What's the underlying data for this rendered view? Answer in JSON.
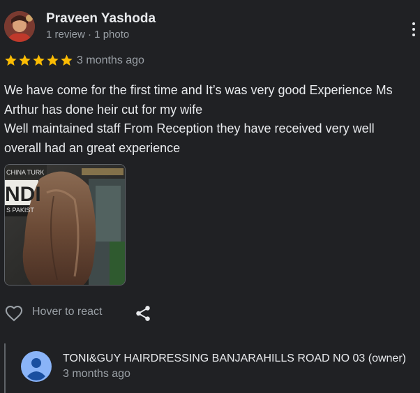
{
  "reviewer": {
    "name": "Praveen Yashoda",
    "meta": "1 review · 1 photo",
    "avatar_icon": "profile-photo"
  },
  "review": {
    "rating": 5,
    "rating_max": 5,
    "star_color": "#fbbc04",
    "date": "3 months ago",
    "text_lines": [
      "We have come for the first time and It’s was very good Experience Ms",
      "Arthur has done heir cut for my wife",
      "Well maintained staff From Reception they have received very well",
      "overall had an great experience"
    ],
    "photo_text": [
      "CHINA TURK",
      "NDI",
      "S PAKIST"
    ]
  },
  "actions": {
    "react_icon": "heart-outline-icon",
    "react_label": "Hover to react",
    "share_icon": "share-icon"
  },
  "owner_reply": {
    "name": "TONI&GUY HAIRDRESSING BANJARAHILLS ROAD NO 03 (owner)",
    "date": "3 months ago",
    "avatar_icon": "default-user-avatar",
    "avatar_color": "#8ab4f8"
  },
  "menu": {
    "icon": "more-vertical-icon"
  }
}
